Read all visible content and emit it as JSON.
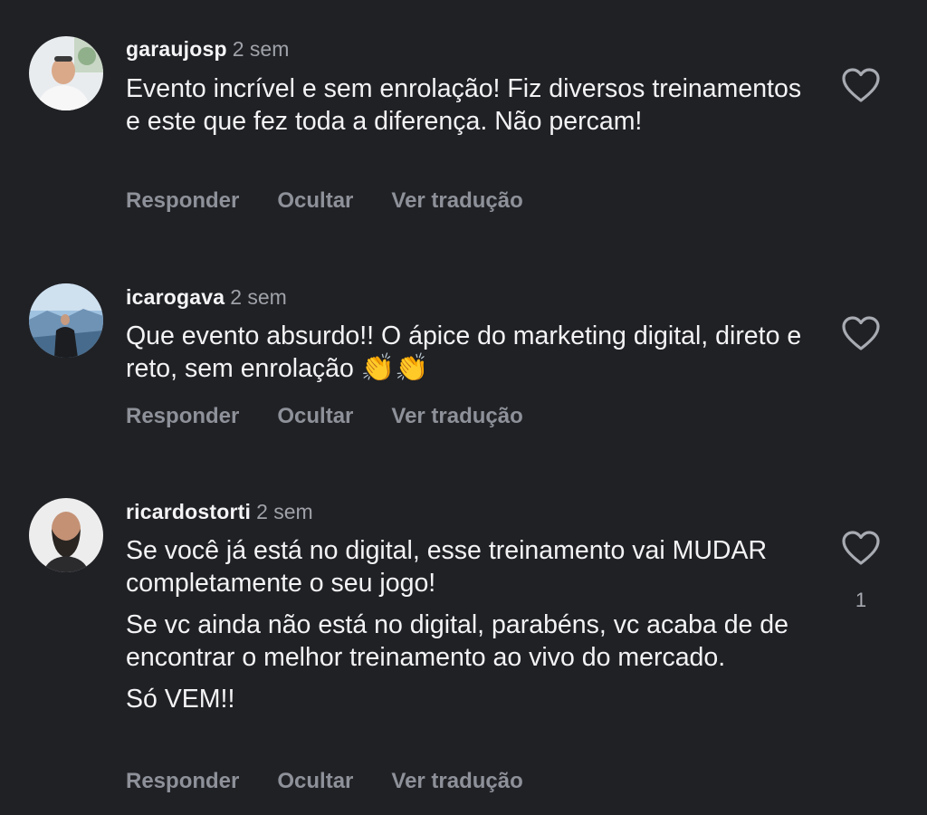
{
  "comments": [
    {
      "username": "garaujosp",
      "time": "2 sem",
      "paragraphs": [
        "Evento incrível e sem enrolação! Fiz diversos treinamentos e este que fez toda a diferença. Não percam!"
      ],
      "actions": {
        "reply": "Responder",
        "hide": "Ocultar",
        "translate": "Ver tradução"
      },
      "like_icon": "heart-outline-icon",
      "like_count": ""
    },
    {
      "username": "icarogava",
      "time": "2 sem",
      "paragraphs": [
        "Que evento absurdo!! O ápice do marketing digital, direto e reto, sem enrolação"
      ],
      "emoji": "👏👏",
      "actions": {
        "reply": "Responder",
        "hide": "Ocultar",
        "translate": "Ver tradução"
      },
      "like_icon": "heart-outline-icon",
      "like_count": ""
    },
    {
      "username": "ricardostorti",
      "time": "2 sem",
      "paragraphs": [
        "Se você já está no digital, esse treinamento vai MUDAR completamente o seu jogo!",
        "Se vc ainda não está no digital, parabéns, vc acaba de de encontrar o melhor treinamento ao vivo do mercado.",
        "Só VEM!!"
      ],
      "actions": {
        "reply": "Responder",
        "hide": "Ocultar",
        "translate": "Ver tradução"
      },
      "like_icon": "heart-outline-icon",
      "like_count": "1"
    }
  ],
  "colors": {
    "background": "#202125",
    "text": "#f3f3f5",
    "muted": "#8e9199",
    "time": "#9fa2a9"
  }
}
